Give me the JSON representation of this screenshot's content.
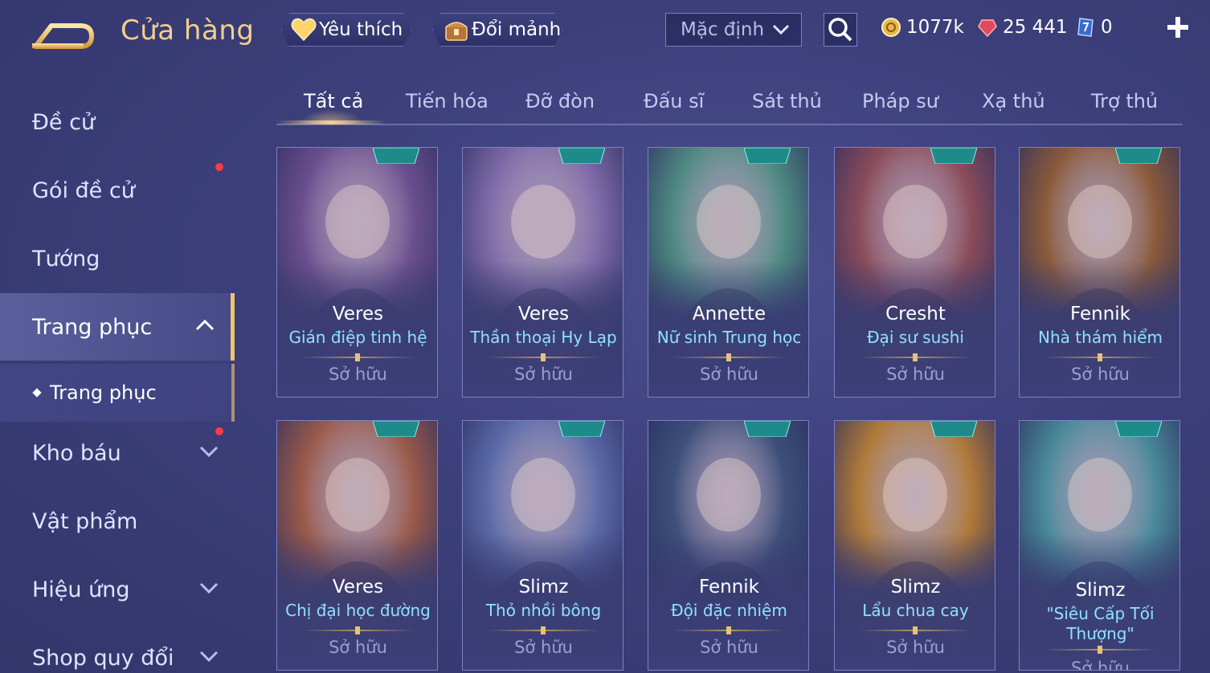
{
  "header": {
    "title": "Cửa hàng",
    "favorite_label": "Yêu thích",
    "exchange_label": "Đổi mảnh",
    "sort_value": "Mặc định",
    "currencies": [
      {
        "name": "gold-coin-icon",
        "value": "1077k"
      },
      {
        "name": "ruby-icon",
        "value": "25 441"
      },
      {
        "name": "voucher-icon",
        "value": "0"
      }
    ]
  },
  "sidebar": {
    "items": [
      {
        "label": "Đề cử"
      },
      {
        "label": "Gói đề cử"
      },
      {
        "label": "Tướng"
      },
      {
        "label": "Trang phục"
      },
      {
        "label": "Kho báu"
      },
      {
        "label": "Vật phẩm"
      },
      {
        "label": "Hiệu ứng"
      },
      {
        "label": "Shop quy đổi"
      }
    ],
    "sub_item": "Trang phục"
  },
  "tabs": [
    "Tất cả",
    "Tiến hóa",
    "Đỡ đòn",
    "Đấu sĩ",
    "Sát thủ",
    "Pháp sư",
    "Xạ thủ",
    "Trợ thủ"
  ],
  "cards": [
    {
      "hero": "Veres",
      "skin": "Gián điệp tinh hệ",
      "status": "Sở hữu",
      "theme": "#6b4f8f"
    },
    {
      "hero": "Veres",
      "skin": "Thần thoại Hy Lạp",
      "status": "Sở hữu",
      "theme": "#7d6aa8"
    },
    {
      "hero": "Annette",
      "skin": "Nữ sinh Trung học",
      "status": "Sở hữu",
      "theme": "#4f8a83"
    },
    {
      "hero": "Cresht",
      "skin": "Đại sư sushi",
      "status": "Sở hữu",
      "theme": "#8a4c5a"
    },
    {
      "hero": "Fennik",
      "skin": "Nhà thám hiểm",
      "status": "Sở hữu",
      "theme": "#8a5a3a"
    },
    {
      "hero": "Veres",
      "skin": "Chị đại học đường",
      "status": "Sở hữu",
      "theme": "#9a5a4a"
    },
    {
      "hero": "Slimz",
      "skin": "Thỏ nhồi bông",
      "status": "Sở hữu",
      "theme": "#5a6aa8"
    },
    {
      "hero": "Fennik",
      "skin": "Đội đặc nhiệm",
      "status": "Sở hữu",
      "theme": "#3d4f7a"
    },
    {
      "hero": "Slimz",
      "skin": "Lẩu chua cay",
      "status": "Sở hữu",
      "theme": "#b07a3a"
    },
    {
      "hero": "Slimz",
      "skin": "\"Siêu Cấp Tối Thượng\"",
      "status": "Sở hữu",
      "theme": "#4a8a9a"
    }
  ],
  "colors": {
    "accent": "#f3d08a",
    "skin_name": "#8fe0ff",
    "notify_dot": "#ff3b48"
  }
}
